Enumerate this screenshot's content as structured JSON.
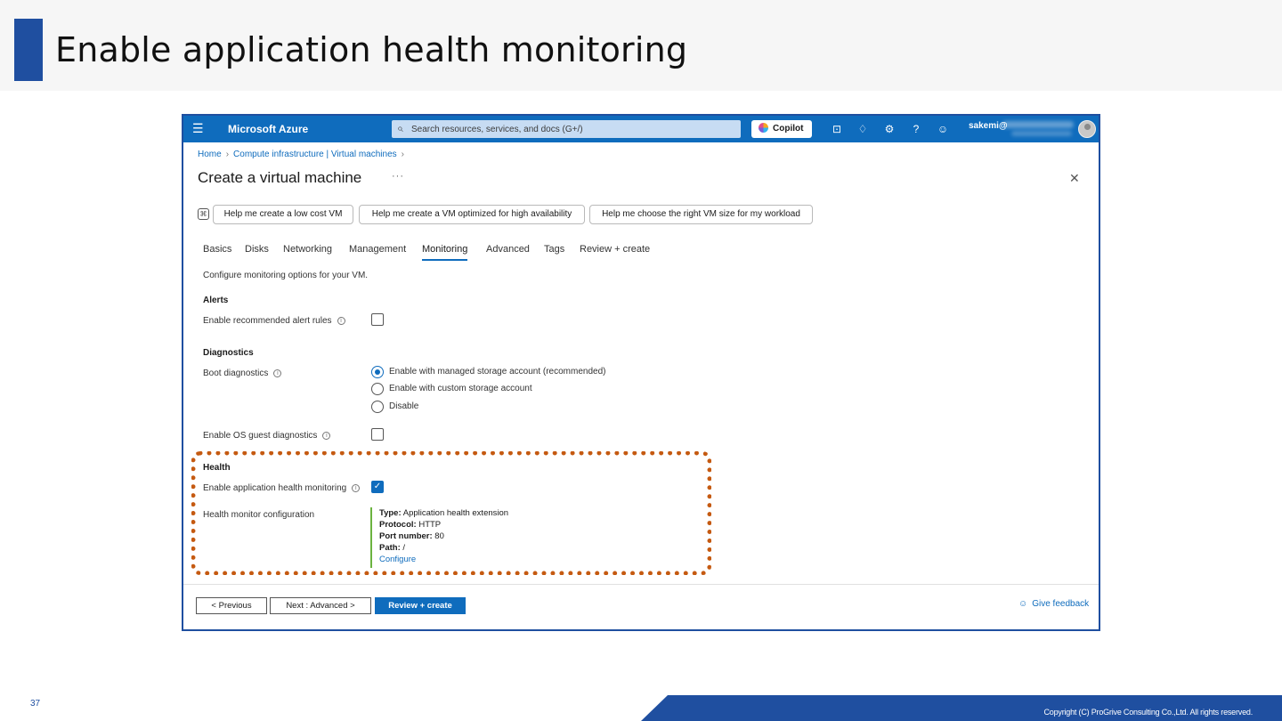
{
  "slide": {
    "title": "Enable application health monitoring",
    "page_number": "37",
    "copyright": "Copyright (C) ProGrive Consulting Co.,Ltd. All rights reserved."
  },
  "topbar": {
    "menu_icon": "hamburger-icon",
    "brand": "Microsoft Azure",
    "search_placeholder": "Search resources, services, and docs (G+/)",
    "copilot_label": "Copilot",
    "icons": [
      "cloud-shell-icon",
      "bell-icon",
      "gear-icon",
      "help-icon",
      "feedback-icon"
    ],
    "user": "sakemi@"
  },
  "breadcrumb": [
    "Home",
    "Compute infrastructure | Virtual machines"
  ],
  "page": {
    "title": "Create a virtual machine",
    "more": "···",
    "close": "✕"
  },
  "chips": [
    "Help me create a low cost VM",
    "Help me create a VM optimized for high availability",
    "Help me choose the right VM size for my workload"
  ],
  "tabs": [
    {
      "label": "Basics",
      "active": false
    },
    {
      "label": "Disks",
      "active": false
    },
    {
      "label": "Networking",
      "active": false
    },
    {
      "label": "Management",
      "active": false
    },
    {
      "label": "Monitoring",
      "active": true
    },
    {
      "label": "Advanced",
      "active": false
    },
    {
      "label": "Tags",
      "active": false
    },
    {
      "label": "Review + create",
      "active": false
    }
  ],
  "form": {
    "description": "Configure monitoring options for your VM.",
    "alerts": {
      "heading": "Alerts",
      "recommended_label": "Enable recommended alert rules",
      "recommended_checked": false
    },
    "diagnostics": {
      "heading": "Diagnostics",
      "boot_label": "Boot diagnostics",
      "boot_options": [
        "Enable with managed storage account (recommended)",
        "Enable with custom storage account",
        "Disable"
      ],
      "boot_selected": 0,
      "os_guest_label": "Enable OS guest diagnostics",
      "os_guest_checked": false
    },
    "health": {
      "heading": "Health",
      "app_health_label": "Enable application health monitoring",
      "app_health_checked": true,
      "config_label": "Health monitor configuration",
      "config": {
        "type_key": "Type:",
        "type_value": "Application health extension",
        "protocol_key": "Protocol:",
        "protocol_value": "HTTP",
        "port_key": "Port number:",
        "port_value": "80",
        "path_key": "Path:",
        "path_value": "/",
        "configure_link": "Configure"
      }
    }
  },
  "footer": {
    "previous": "< Previous",
    "next": "Next : Advanced >",
    "review": "Review + create",
    "feedback": "Give feedback"
  },
  "colors": {
    "azure_blue": "#0f6cbd",
    "slide_blue": "#1f4fa0",
    "highlight": "#c55a11",
    "health_bar": "#6bb33f"
  }
}
